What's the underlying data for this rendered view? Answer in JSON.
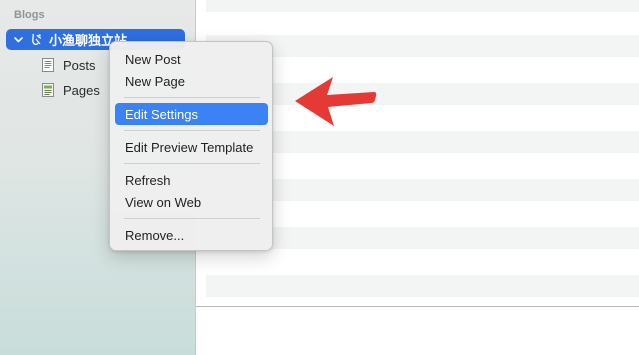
{
  "sidebar": {
    "section_header": "Blogs",
    "blog": {
      "name": "小渔聊独立站",
      "icon": "blog-icon"
    },
    "items": [
      {
        "label": "Posts",
        "icon": "document-icon"
      },
      {
        "label": "Pages",
        "icon": "page-icon"
      }
    ]
  },
  "context_menu": {
    "items": [
      {
        "label": "New Post"
      },
      {
        "label": "New Page"
      },
      {
        "label": "Edit Settings",
        "active": true
      },
      {
        "label": "Edit Preview Template"
      },
      {
        "label": "Refresh"
      },
      {
        "label": "View on Web"
      },
      {
        "label": "Remove..."
      }
    ]
  },
  "colors": {
    "selection": "#2f6fe0",
    "menu_highlight": "#3b82f6",
    "annotation_arrow": "#e53935"
  }
}
